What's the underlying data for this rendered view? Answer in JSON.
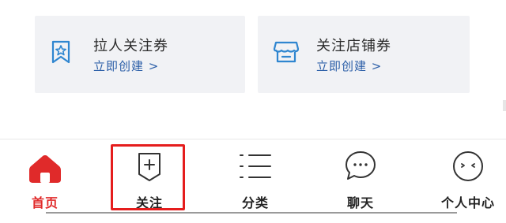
{
  "cards": [
    {
      "title": "拉人关注券",
      "action": "立即创建 >",
      "icon": "ribbon-star-icon"
    },
    {
      "title": "关注店铺券",
      "action": "立即创建 >",
      "icon": "store-awning-icon"
    }
  ],
  "tabs": [
    {
      "label": "首页",
      "icon": "home-icon",
      "active": true
    },
    {
      "label": "关注",
      "icon": "follow-bookmark-icon",
      "active": false
    },
    {
      "label": "分类",
      "icon": "menu-lines-icon",
      "active": false
    },
    {
      "label": "聊天",
      "icon": "chat-bubble-icon",
      "active": false
    },
    {
      "label": "个人中心",
      "icon": "profile-face-icon",
      "active": false
    }
  ],
  "colors": {
    "accent_red": "#e02a2a",
    "link_blue": "#2c5fa8",
    "icon_blue": "#2f86d0",
    "card_bg": "#f1f2f5",
    "highlight_border": "#e51d1d"
  }
}
